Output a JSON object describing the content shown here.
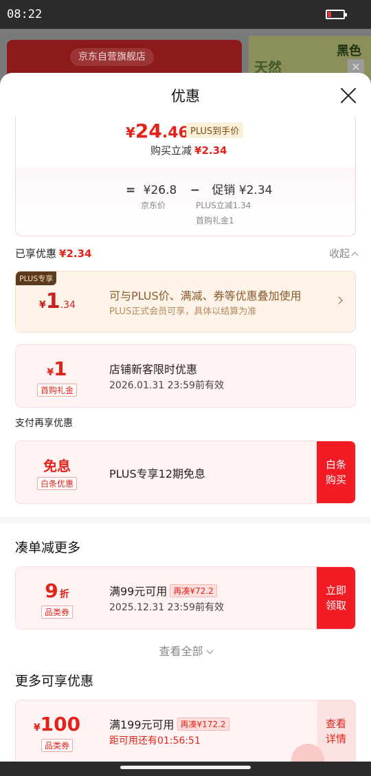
{
  "status_bar": {
    "time": "08:22",
    "battery_level": 0.2
  },
  "background": {
    "store_name": "京东自营旗舰店",
    "product_text": "天然",
    "product_badge": "黑色",
    "close_glyph": "✕"
  },
  "sheet": {
    "title": "优惠",
    "price": {
      "yen": "¥",
      "int": "24",
      "dec": ".46",
      "plus_tag": "PLUS到手价",
      "buy_reduce_label": "购买立减",
      "buy_reduce_value": "¥2.34",
      "equals": "=",
      "jd_price": "¥26.8",
      "minus": "−",
      "promo_label": "促销",
      "promo_value": "¥2.34",
      "jd_price_label": "京东价",
      "plus_reduce": "PLUS立减1.34",
      "first_gift": "首购礼金1"
    },
    "enjoyed": {
      "label": "已享优惠",
      "value": "¥2.34",
      "collapse": "收起"
    },
    "plus_card": {
      "badge": "PLUS专享",
      "yen": "¥",
      "int": "1",
      "dec": ".34",
      "line1": "可与PLUS价、满减、券等优惠叠加使用",
      "line2": "PLUS正式会员可享，具体以结算为准"
    },
    "new_customer": {
      "yen": "¥",
      "int": "1",
      "label": "首购礼金",
      "line1": "店铺新客限时优惠",
      "line2": "2026.01.31 23:59前有效"
    },
    "pay_section": "支付再享优惠",
    "baitiao": {
      "title": "免息",
      "label": "白条优惠",
      "line1": "PLUS专享12期免息",
      "btn_line1": "白条",
      "btn_line2": "购买"
    },
    "more_reduce": {
      "heading": "凑单减更多",
      "coupon": {
        "int": "9",
        "unit": "折",
        "label": "品类券",
        "line1": "满99元可用",
        "tag": "再凑¥72.2",
        "line2": "2025.12.31 23:59前有效",
        "btn_line1": "立即",
        "btn_line2": "领取"
      },
      "view_all": "查看全部"
    },
    "more_offers": {
      "heading": "更多可享优惠",
      "coupon": {
        "yen": "¥",
        "int": "100",
        "label": "品类券",
        "line1": "满199元可用",
        "tag": "再凑¥172.2",
        "line2": "距可用还有01:56:51",
        "btn_line1": "查看",
        "btn_line2": "详情"
      }
    }
  }
}
